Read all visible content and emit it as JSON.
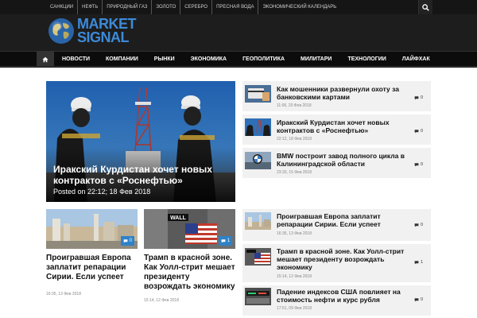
{
  "top_nav": [
    "Санкции",
    "Нефть",
    "Природный газ",
    "Золото",
    "Серебро",
    "Пресная вода",
    "Экономический календарь"
  ],
  "logo": {
    "line1": "MARKET",
    "line2": "SIGNAL"
  },
  "main_nav": [
    "Новости",
    "Компании",
    "Рынки",
    "Экономика",
    "Геополитика",
    "Милитари",
    "Технологии",
    "Лайфхак"
  ],
  "hero": {
    "title": "Иракский Курдистан хочет новых контрактов с «Роснефтью»",
    "date": "Posted on 22:12; 18 Фев 2018"
  },
  "cards": [
    {
      "title": "Проигравшая Европа заплатит репарации Сирии. Если успеет",
      "date": "16:35, 13 Фев 2018",
      "comments": "0"
    },
    {
      "title": "Трамп в красной зоне. Как Уолл-стрит мешает президенту возрождать экономику",
      "date": "15:14, 12 Фев 2018",
      "comments": "1"
    }
  ],
  "side_top": [
    {
      "title": "Как мошенники развернули охоту за банковскими картами",
      "date": "11:06, 20 Фев 2018",
      "comments": "0"
    },
    {
      "title": "Иракский Курдистан хочет новых контрактов с «Роснефтью»",
      "date": "22:12, 18 Фев 2018",
      "comments": "0"
    },
    {
      "title": "BMW построит завод полного цикла в Калининградской области",
      "date": "23:33, 15 Фев 2018",
      "comments": "0"
    }
  ],
  "side_bottom": [
    {
      "title": "Проигравшая Европа заплатит репарации Сирии. Если успеет",
      "date": "16:35, 13 Фев 2018",
      "comments": "0"
    },
    {
      "title": "Трамп в красной зоне. Как Уолл-стрит мешает президенту возрождать экономику",
      "date": "15:14, 12 Фев 2018",
      "comments": "1"
    },
    {
      "title": "Падение индексов США повлияет на стоимость нефти и курс рубля",
      "date": "17:51, 09 Фев 2018",
      "comments": "0"
    }
  ],
  "colors": {
    "accent": "#2e82c8",
    "logo_blue": "#3d8ad8",
    "dark_bg": "#111111"
  }
}
